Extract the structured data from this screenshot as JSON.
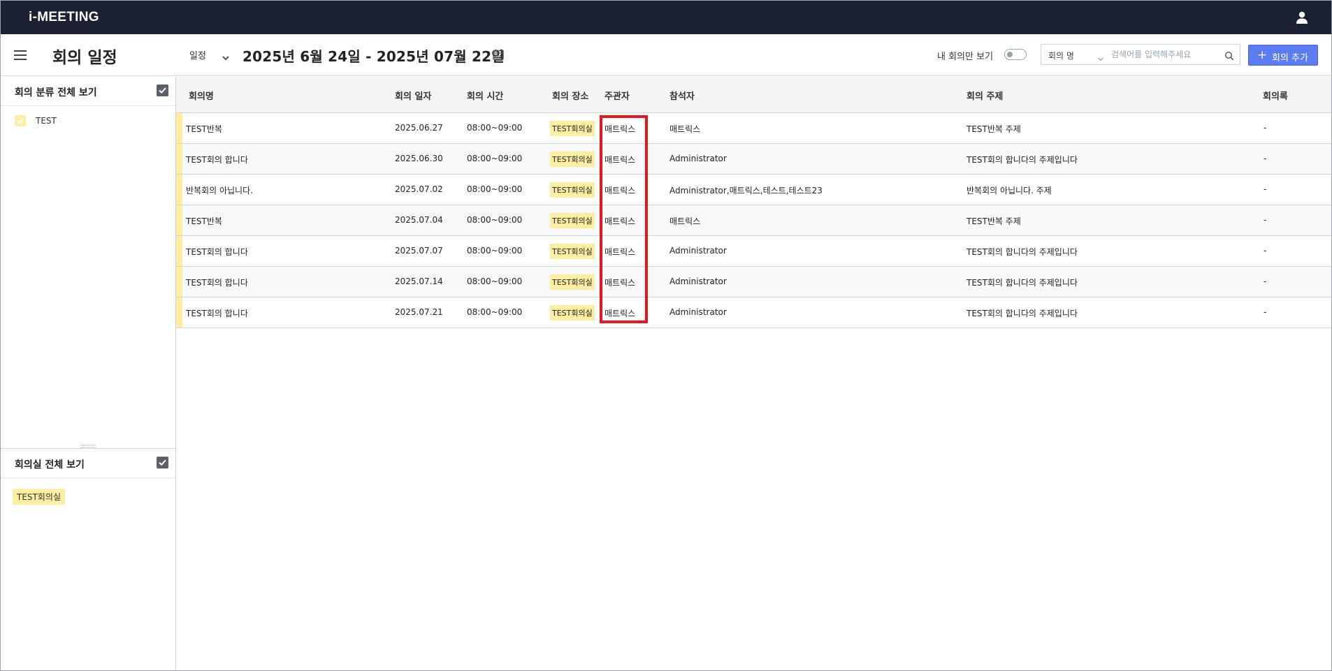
{
  "app": {
    "title": "i-MEETING"
  },
  "header": {
    "page_title": "회의 일정",
    "view_select": "일정",
    "date_range": "2025년 6월 24일 - 2025년 07월 22일",
    "mine_only_label": "내 회의만 보기",
    "mine_only_checked": false,
    "search_field": "회의 명",
    "search_placeholder": "검색어를 입력해주세요",
    "search_value": "",
    "add_button_label": "회의 추가",
    "accent_color": "#5b7cf0"
  },
  "sidebar": {
    "category_title": "회의 분류 전체 보기",
    "category_all_checked": true,
    "categories": [
      {
        "label": "TEST",
        "color": "#fbeea0",
        "checked": true
      }
    ],
    "room_title": "회의실 전체 보기",
    "room_all_checked": true,
    "rooms": [
      {
        "label": "TEST회의실",
        "color": "#fbeea0"
      }
    ]
  },
  "table": {
    "columns": [
      "회의명",
      "회의 일자",
      "회의 시간",
      "회의 장소",
      "주관자",
      "참석자",
      "회의 주제",
      "회의록"
    ],
    "rows": [
      {
        "name": "TEST반복",
        "date": "2025.06.27",
        "time": "08:00~09:00",
        "location": "TEST회의실",
        "host": "매트릭스",
        "attendees": "매트릭스",
        "topic": "TEST반복 주제",
        "minutes": "-"
      },
      {
        "name": "TEST회의 합니다",
        "date": "2025.06.30",
        "time": "08:00~09:00",
        "location": "TEST회의실",
        "host": "매트릭스",
        "attendees": "Administrator",
        "topic": "TEST회의 합니다의 주제입니다",
        "minutes": "-"
      },
      {
        "name": "반복회의 아닙니다.",
        "date": "2025.07.02",
        "time": "08:00~09:00",
        "location": "TEST회의실",
        "host": "매트릭스",
        "attendees": "Administrator,매트릭스,테스트,테스트23",
        "topic": "반복회의 아닙니다. 주제",
        "minutes": "-"
      },
      {
        "name": "TEST반복",
        "date": "2025.07.04",
        "time": "08:00~09:00",
        "location": "TEST회의실",
        "host": "매트릭스",
        "attendees": "매트릭스",
        "topic": "TEST반복 주제",
        "minutes": "-"
      },
      {
        "name": "TEST회의 합니다",
        "date": "2025.07.07",
        "time": "08:00~09:00",
        "location": "TEST회의실",
        "host": "매트릭스",
        "attendees": "Administrator",
        "topic": "TEST회의 합니다의 주제입니다",
        "minutes": "-"
      },
      {
        "name": "TEST회의 합니다",
        "date": "2025.07.14",
        "time": "08:00~09:00",
        "location": "TEST회의실",
        "host": "매트릭스",
        "attendees": "Administrator",
        "topic": "TEST회의 합니다의 주제입니다",
        "minutes": "-"
      },
      {
        "name": "TEST회의 합니다",
        "date": "2025.07.21",
        "time": "08:00~09:00",
        "location": "TEST회의실",
        "host": "매트릭스",
        "attendees": "Administrator",
        "topic": "TEST회의 합니다의 주제입니다",
        "minutes": "-"
      }
    ]
  },
  "highlight": {
    "column": "주관자",
    "color": "#e8161c"
  }
}
